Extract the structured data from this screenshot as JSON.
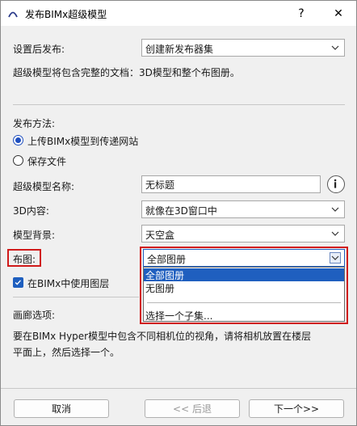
{
  "window": {
    "title": "发布BIMx超级模型"
  },
  "titlebar": {
    "help_glyph": "?",
    "close_glyph": "✕"
  },
  "after_publish": {
    "label": "设置后发布:",
    "value": "创建新发布器集"
  },
  "info_text": "超级模型将包含完整的文档：3D模型和整个布图册。",
  "method": {
    "label": "发布方法:",
    "options": [
      {
        "label": "上传BIMx模型到传递网站",
        "selected": true
      },
      {
        "label": "保存文件",
        "selected": false
      }
    ]
  },
  "name": {
    "label": "超级模型名称:",
    "value": "无标题"
  },
  "content3d": {
    "label": "3D内容:",
    "value": "就像在3D窗口中"
  },
  "background": {
    "label": "模型背景:",
    "value": "天空盒"
  },
  "layout": {
    "label": "布图:",
    "value": "全部图册",
    "options": [
      "全部图册",
      "无图册",
      "选择一个子集..."
    ],
    "selected_index": 0
  },
  "use_layers": {
    "label": "在BIMx中使用图层",
    "checked": true
  },
  "gallery": {
    "label": "画廊选项:",
    "description_line1": "要在BIMx Hyper模型中包含不同相机位的视角，请将相机放置在楼层",
    "description_line2": "平面上，然后选择一个。"
  },
  "buttons": {
    "cancel": "取消",
    "back": "<< 后退",
    "next": "下一个>>"
  },
  "colors": {
    "accent": "#1f5fbf",
    "highlight_box": "#d01a1a"
  },
  "icons": {
    "app": "bimx-arc-icon",
    "info": "info-icon",
    "dropdown_arrow": "chevron-down-icon",
    "check": "check-icon"
  }
}
